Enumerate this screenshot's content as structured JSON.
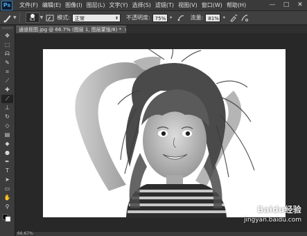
{
  "app": {
    "logo": "Ps"
  },
  "menu": [
    "文件(F)",
    "编辑(E)",
    "图像(I)",
    "图层(L)",
    "文字(Y)",
    "选择(S)",
    "滤镜(T)",
    "视图(V)",
    "窗口(W)",
    "帮助(H)"
  ],
  "window_controls": {
    "minimize": "—",
    "maximize": "□",
    "close": "✕"
  },
  "options": {
    "brush_size": "63",
    "mode_label": "模式:",
    "mode_value": "正常",
    "opacity_label": "不透明度:",
    "opacity_value": "75%",
    "flow_label": "流量:",
    "flow_value": "81%"
  },
  "document": {
    "tab_title": "通道抠图.jpg @ 66.7% (图层 1, 图层蒙版/8) *",
    "tab_close": "×"
  },
  "status": {
    "zoom": "66.67%"
  },
  "watermark": {
    "logo_text": "Baidu经验",
    "url": "jingyan.baidu.com"
  },
  "icons": [
    "brush-icon",
    "brush-preset-icon",
    "brush-panel-icon",
    "pressure-opacity-icon",
    "airbrush-icon",
    "pressure-size-icon",
    "move-tool-icon",
    "marquee-tool-icon",
    "lasso-tool-icon",
    "quick-select-tool-icon",
    "crop-tool-icon",
    "eyedropper-tool-icon",
    "healing-brush-tool-icon",
    "brush-tool-icon",
    "clone-stamp-tool-icon",
    "history-brush-tool-icon",
    "eraser-tool-icon",
    "gradient-tool-icon",
    "blur-tool-icon",
    "dodge-tool-icon",
    "pen-tool-icon",
    "type-tool-icon",
    "path-select-tool-icon",
    "shape-tool-icon",
    "hand-tool-icon",
    "zoom-tool-icon"
  ],
  "colors": {
    "ui_dark": "#282828",
    "panel": "#3c3c3c",
    "canvas": "#ffffff"
  }
}
